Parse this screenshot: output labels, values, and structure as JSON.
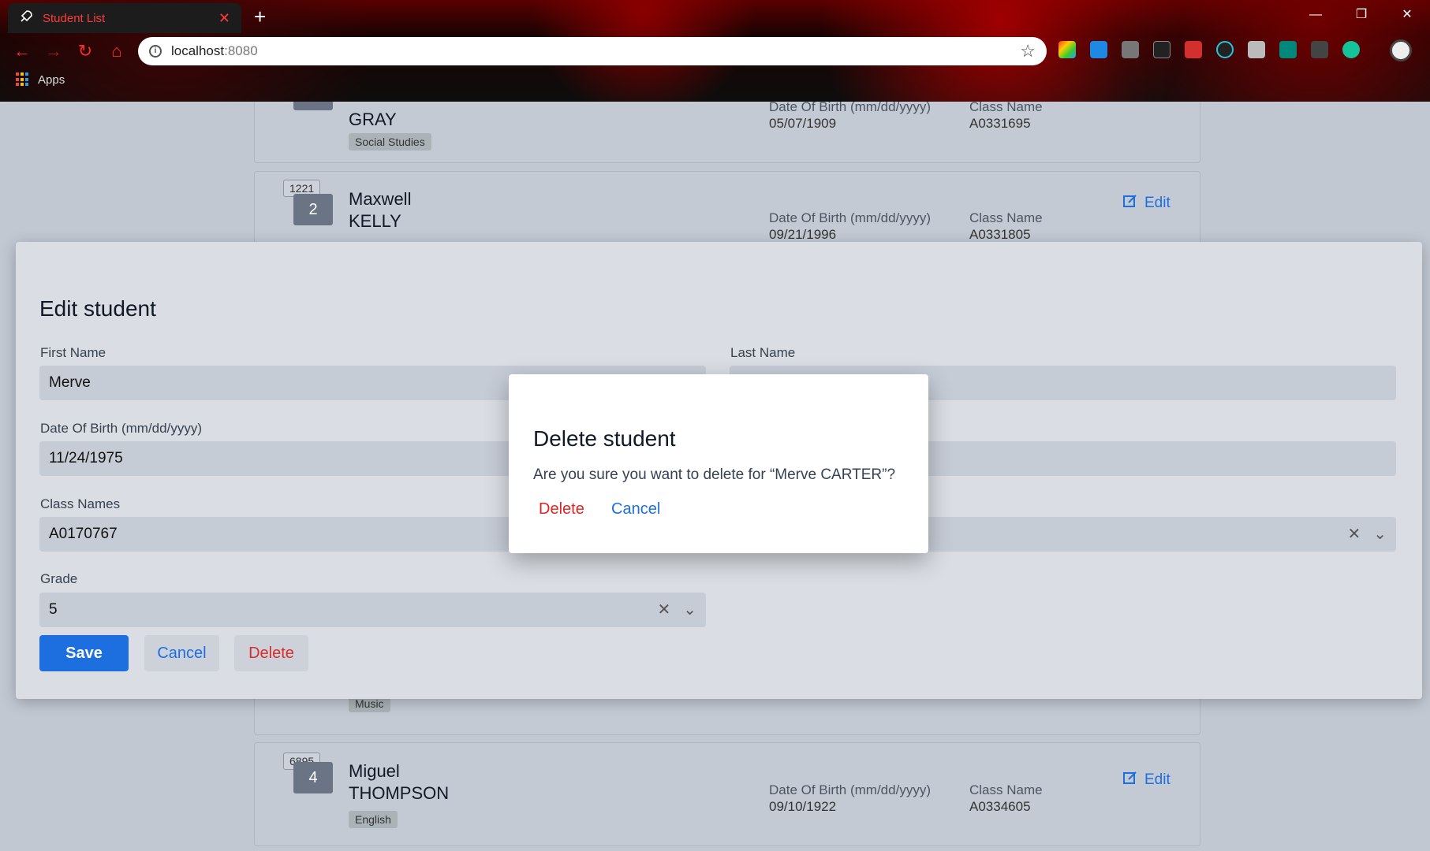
{
  "browser": {
    "tab_title": "Student List",
    "url_host": "localhost",
    "url_port": ":8080",
    "bookmarks_label": "Apps"
  },
  "students": [
    {
      "last": "GRAY",
      "subject": "Social Studies",
      "dob_label": "Date Of Birth (mm/dd/yyyy)",
      "dob": "05/07/1909",
      "class_label": "Class Name",
      "class": "A0331695"
    },
    {
      "id": "1221",
      "num": "2",
      "first": "Maxwell",
      "last": "KELLY",
      "dob_label": "Date Of Birth (mm/dd/yyyy)",
      "dob": "09/21/1996",
      "class_label": "Class Name",
      "class": "A0331805",
      "edit": "Edit"
    },
    {
      "subject": "Music"
    },
    {
      "id": "6895",
      "num": "4",
      "first": "Miguel",
      "last": "THOMPSON",
      "subject": "English",
      "dob_label": "Date Of Birth (mm/dd/yyyy)",
      "dob": "09/10/1922",
      "class_label": "Class Name",
      "class": "A0334605",
      "edit": "Edit"
    }
  ],
  "edit_modal": {
    "title": "Edit student",
    "first_name_label": "First Name",
    "first_name": "Merve",
    "last_name_label": "Last Name",
    "last_name": "",
    "dob_label": "Date Of Birth (mm/dd/yyyy)",
    "dob": "11/24/1975",
    "class_names_label": "Class Names",
    "class_names": "A0170767",
    "grade_label": "Grade",
    "grade": "5",
    "save": "Save",
    "cancel": "Cancel",
    "delete": "Delete"
  },
  "confirm_modal": {
    "title": "Delete student",
    "message": "Are you sure you want to delete for “Merve CARTER”?",
    "delete": "Delete",
    "cancel": "Cancel"
  },
  "colors": {
    "primary": "#1d6fe0",
    "danger": "#e02424",
    "browser_accent": "#ff2b2b"
  }
}
